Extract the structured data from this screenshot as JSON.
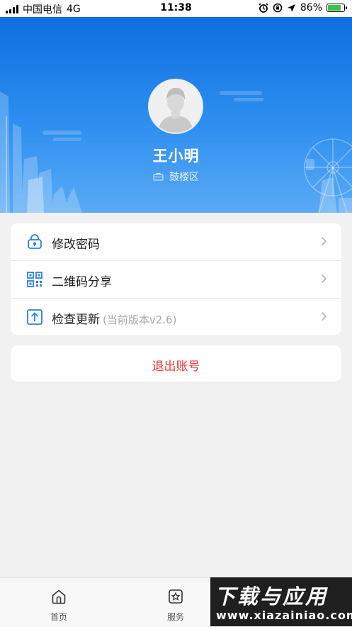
{
  "status_bar": {
    "carrier": "中国电信",
    "network": "4G",
    "time": "11:38",
    "battery": "86%",
    "battery_level": 0.86
  },
  "profile": {
    "name": "王小明",
    "department": "鼓楼区"
  },
  "menu": {
    "items": [
      {
        "label": "修改密码",
        "hint": ""
      },
      {
        "label": "二维码分享",
        "hint": ""
      },
      {
        "label": "检查更新",
        "hint": "(当前版本v2.6)"
      }
    ]
  },
  "logout": {
    "label": "退出账号"
  },
  "tabbar": {
    "home_label": "首页",
    "service_label": "服务"
  },
  "watermark": {
    "title": "下载与应用",
    "url": "www.xiazainiao.com"
  },
  "colors": {
    "header_blue": "#1e7fe8",
    "icon_blue": "#2b7de0",
    "logout_red": "#e53935",
    "battery_green": "#3ac34a"
  }
}
